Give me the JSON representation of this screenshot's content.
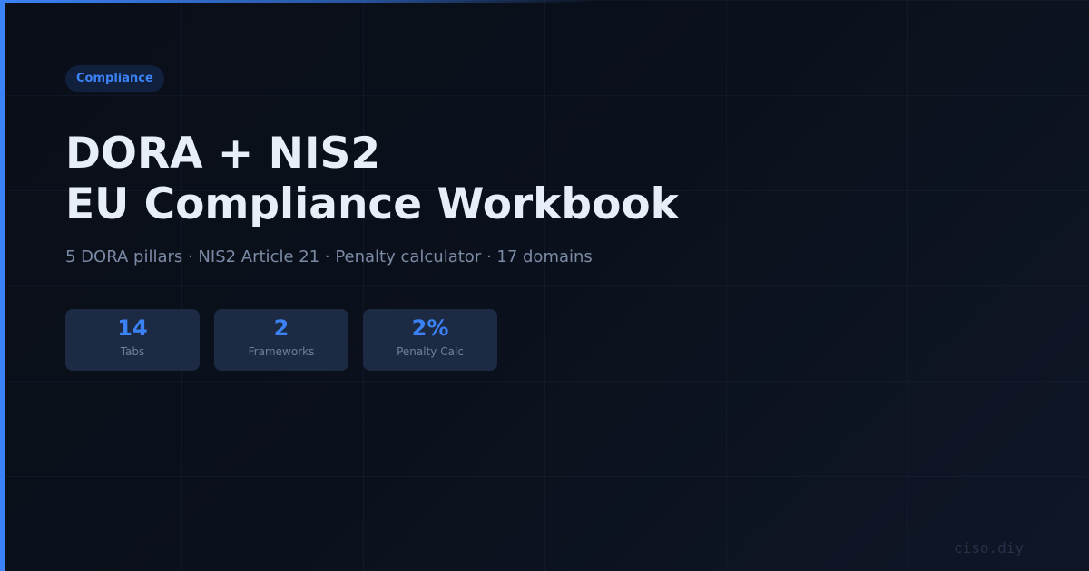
{
  "badge": "Compliance",
  "title": {
    "line1": "DORA + NIS2",
    "line2": "EU Compliance Workbook"
  },
  "subtitle": "5 DORA pillars · NIS2 Article 21 · Penalty calculator · 17 domains",
  "stats": [
    {
      "value": "14",
      "label": "Tabs"
    },
    {
      "value": "2",
      "label": "Frameworks"
    },
    {
      "value": "2%",
      "label": "Penalty Calc"
    }
  ],
  "footer": "ciso.diy",
  "colors": {
    "accent": "#3b82f6",
    "background": "#0a0f1a",
    "title": "#e8eef8",
    "subtitle": "#7b8aa5",
    "stat_card": "#1d2a44"
  }
}
